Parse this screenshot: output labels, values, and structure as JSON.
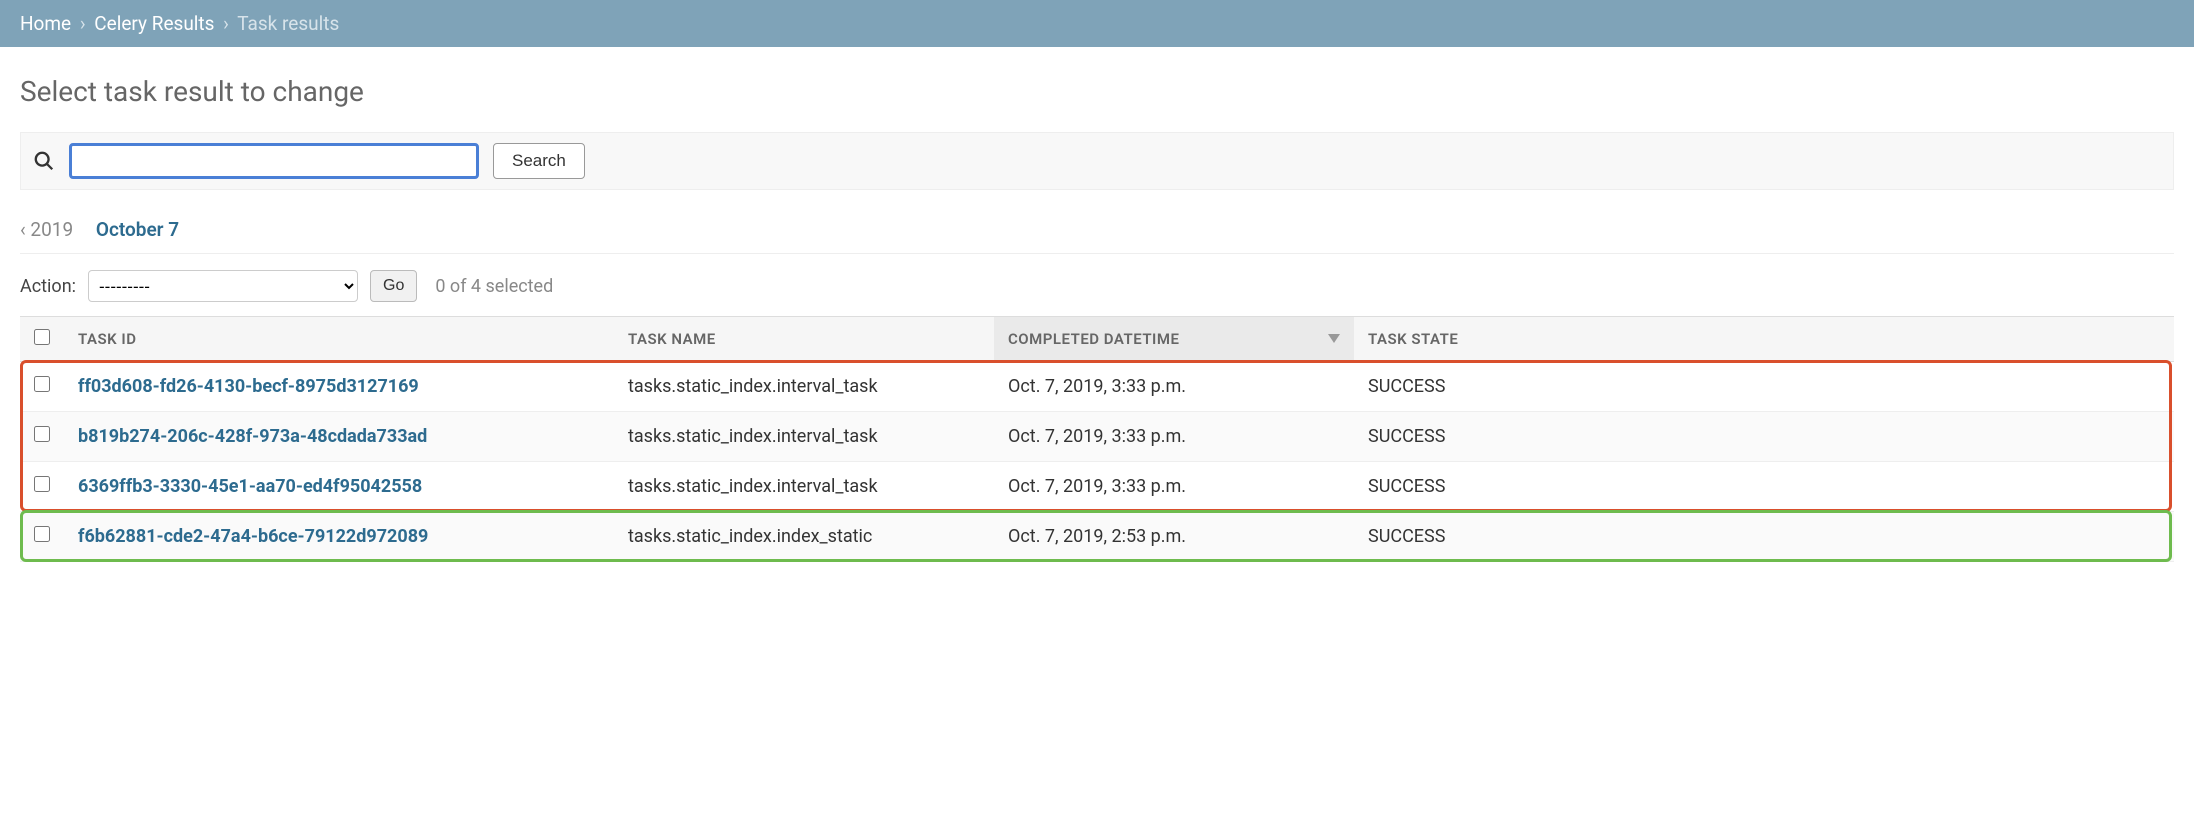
{
  "breadcrumb": {
    "home": "Home",
    "app": "Celery Results",
    "current": "Task results"
  },
  "page_title": "Select task result to change",
  "search": {
    "placeholder": "",
    "button_label": "Search",
    "value": ""
  },
  "date_nav": {
    "prev_year": "‹ 2019",
    "current": "October 7"
  },
  "action": {
    "label": "Action:",
    "selected": "---------",
    "go_label": "Go",
    "count_text": "0 of 4 selected"
  },
  "columns": {
    "task_id": "TASK ID",
    "task_name": "TASK NAME",
    "completed": "COMPLETED DATETIME",
    "state": "TASK STATE"
  },
  "rows": [
    {
      "id": "ff03d608-fd26-4130-becf-8975d3127169",
      "name": "tasks.static_index.interval_task",
      "completed": "Oct. 7, 2019, 3:33 p.m.",
      "state": "SUCCESS"
    },
    {
      "id": "b819b274-206c-428f-973a-48cdada733ad",
      "name": "tasks.static_index.interval_task",
      "completed": "Oct. 7, 2019, 3:33 p.m.",
      "state": "SUCCESS"
    },
    {
      "id": "6369ffb3-3330-45e1-aa70-ed4f95042558",
      "name": "tasks.static_index.interval_task",
      "completed": "Oct. 7, 2019, 3:33 p.m.",
      "state": "SUCCESS"
    },
    {
      "id": "f6b62881-cde2-47a4-b6ce-79122d972089",
      "name": "tasks.static_index.index_static",
      "completed": "Oct. 7, 2019, 2:53 p.m.",
      "state": "SUCCESS"
    }
  ],
  "highlights": {
    "orange_rows": [
      0,
      1,
      2
    ],
    "green_rows": [
      3
    ]
  }
}
